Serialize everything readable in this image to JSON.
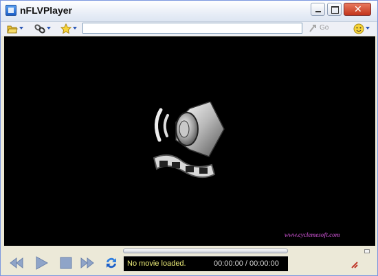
{
  "window": {
    "title": "nFLVPlayer"
  },
  "toolbar": {
    "go_label": "Go",
    "url_value": ""
  },
  "video": {
    "watermark": "www.cyclemesoft.com"
  },
  "status": {
    "message": "No movie loaded.",
    "time": "00:00:00 / 00:00:00"
  },
  "colors": {
    "accent": "#2b57b5",
    "video_bg": "#000000",
    "status_text": "#f0f07a",
    "watermark": "#9b3fa0"
  },
  "icons": [
    "app-icon",
    "open-folder-icon",
    "link-icon",
    "star-icon",
    "go-icon",
    "help-icon",
    "previous-icon",
    "play-icon",
    "stop-icon",
    "next-icon",
    "repeat-icon",
    "speaker-film-icon",
    "resize-icon"
  ]
}
